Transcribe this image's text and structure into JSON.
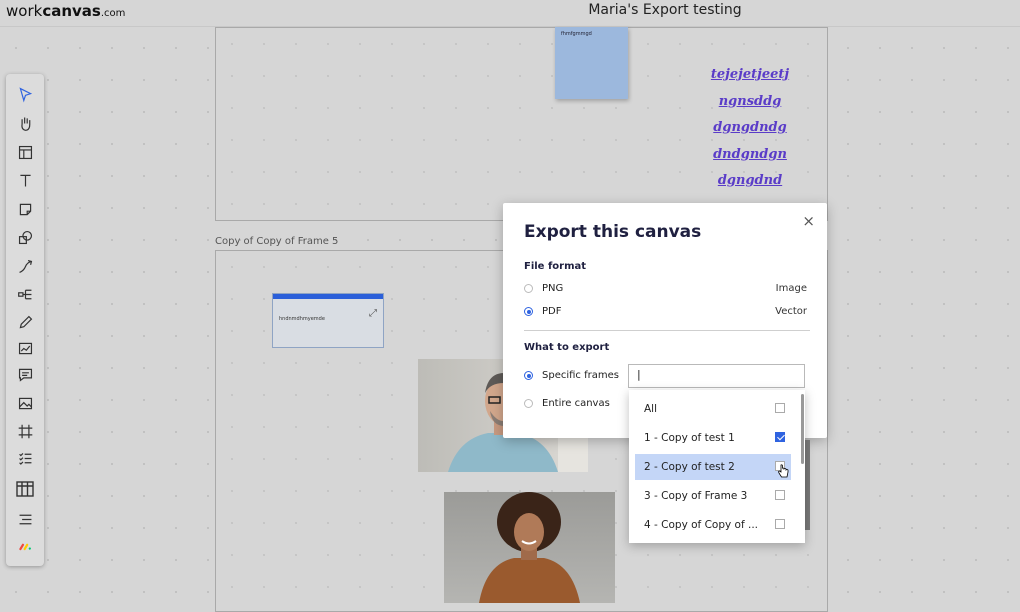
{
  "app": {
    "logo_main": "work",
    "logo_bold": "canvas",
    "logo_suffix": ".com",
    "board_title": "Maria's Export testing"
  },
  "toolbar": {
    "tools": [
      {
        "name": "select-icon"
      },
      {
        "name": "hand-icon"
      },
      {
        "name": "frame-template-icon"
      },
      {
        "name": "text-icon"
      },
      {
        "name": "sticky-note-icon"
      },
      {
        "name": "shapes-icon"
      },
      {
        "name": "connector-icon"
      },
      {
        "name": "mindmap-icon"
      },
      {
        "name": "pen-icon"
      },
      {
        "name": "chart-icon"
      },
      {
        "name": "comment-icon"
      },
      {
        "name": "image-icon"
      },
      {
        "name": "frame-icon"
      },
      {
        "name": "checklist-icon"
      },
      {
        "name": "table-icon"
      },
      {
        "name": "outline-icon"
      },
      {
        "name": "monday-icon"
      }
    ]
  },
  "canvas": {
    "frame_label": "Copy of Copy of Frame 5",
    "sticky_text": "fhmfgmmgd",
    "handwriting": [
      "tejejetjeetj",
      "ngnsddg",
      "dgngdndg",
      "dndgndgn",
      "dgngdnd"
    ],
    "card_text": "hndnmdhmyemde"
  },
  "dialog": {
    "title": "Export this canvas",
    "file_format_label": "File format",
    "png_label": "PNG",
    "png_kind": "Image",
    "pdf_label": "PDF",
    "pdf_kind": "Vector",
    "selected_format": "PDF",
    "what_label": "What to export",
    "specific_label": "Specific frames",
    "entire_label": "Entire canvas",
    "selected_scope": "Specific frames",
    "frames_input_value": "|",
    "close_symbol": "×"
  },
  "dropdown": {
    "items": [
      {
        "label": "All",
        "checked": false
      },
      {
        "label": "1 - Copy of test 1",
        "checked": true
      },
      {
        "label": "2 - Copy of test 2",
        "checked": false,
        "highlighted": true
      },
      {
        "label": "3 - Copy of Frame 3",
        "checked": false
      },
      {
        "label": "4 - Copy of Copy of ...",
        "checked": false
      }
    ]
  },
  "colors": {
    "accent": "#2f63e0",
    "sticky": "#9cb8dd",
    "handwriting": "#5a3cc8",
    "highlight": "#c4d6f7"
  }
}
